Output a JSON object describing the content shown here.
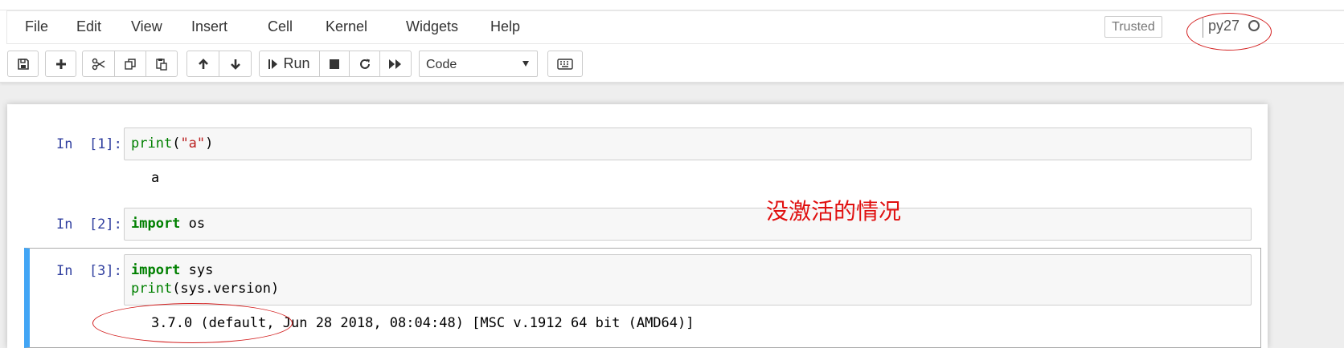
{
  "menubar": {
    "items": [
      "File",
      "Edit",
      "View",
      "Insert",
      "Cell",
      "Kernel",
      "Widgets",
      "Help"
    ],
    "trusted_label": "Trusted",
    "kernel_name": "py27"
  },
  "toolbar": {
    "run_label": "Run",
    "cell_type": "Code",
    "icons": [
      "save-icon",
      "plus-icon",
      "cut-icon",
      "copy-icon",
      "paste-icon",
      "arrow-up-icon",
      "arrow-down-icon",
      "run-icon",
      "stop-icon",
      "restart-icon",
      "fast-forward-icon",
      "keyboard-icon"
    ]
  },
  "cells": [
    {
      "prompt": "In  [1]:",
      "code": {
        "fn": "print",
        "open": "(",
        "str": "\"a\"",
        "close": ")"
      },
      "output": "a"
    },
    {
      "prompt": "In  [2]:",
      "code": {
        "kw": "import",
        "rest": " os"
      }
    },
    {
      "prompt": "In  [3]:",
      "code": {
        "line1_kw": "import",
        "line1_rest": " sys",
        "line2_fn": "print",
        "line2_rest": "(sys.version)"
      },
      "output": "3.7.0 (default, Jun 28 2018, 08:04:48) [MSC v.1912 64 bit (AMD64)]"
    }
  ],
  "annotation": {
    "text": "没激活的情况",
    "color": "#e01010"
  },
  "colors": {
    "selected_cell_bar": "#42a5f5",
    "prompt_blue": "#303f9f",
    "keyword_green": "#008000",
    "string_red": "#ba2121"
  }
}
